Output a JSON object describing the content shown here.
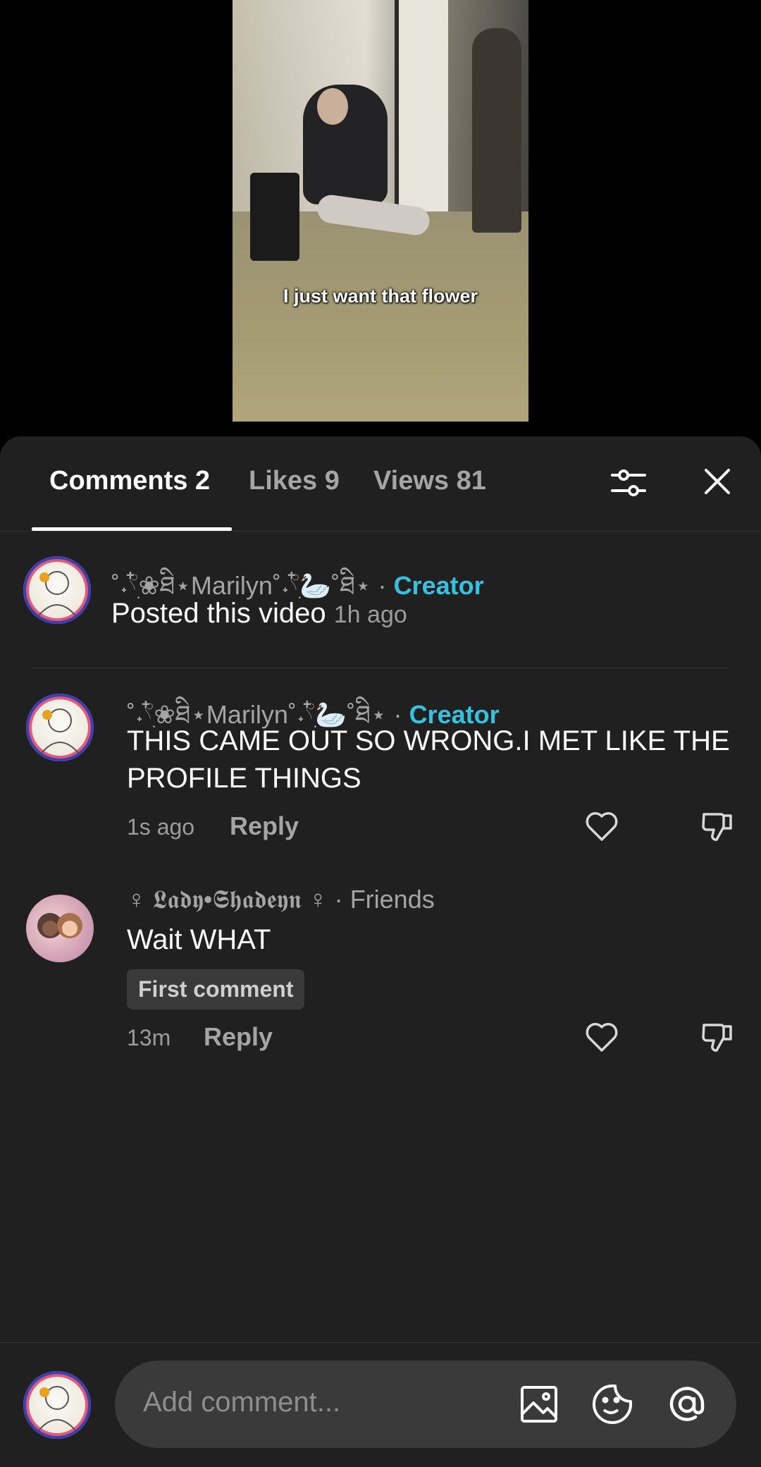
{
  "video": {
    "caption": "I just want that  flower"
  },
  "tabs": [
    {
      "label": "Comments 2",
      "active": true
    },
    {
      "label": "Likes 9",
      "active": false
    },
    {
      "label": "Views 81",
      "active": false
    }
  ],
  "icons": {
    "filter": "sliders-icon",
    "close": "close-icon",
    "like": "heart-icon",
    "dislike": "thumbs-down-icon",
    "image": "image-icon",
    "emoji": "emoji-icon",
    "mention": "at-icon"
  },
  "colors": {
    "creator": "#34c2e0",
    "sheet_bg": "#202020"
  },
  "post": {
    "username": "˚˖𓍢ִ໋❀ཐི⋆Marilyn˚˖𓍢ִ໋🦢˚ཐི⋆",
    "separator": "·",
    "role": "Creator",
    "text": "Posted this video",
    "time": "1h ago"
  },
  "comments": [
    {
      "username": "˚˖𓍢ִ໋❀ཐི⋆Marilyn˚˖𓍢ִ໋🦢˚ཐི⋆",
      "separator": "·",
      "role": "Creator",
      "text": "THIS CAME OUT SO WRONG.I MET LIKE THE PROFILE THINGS",
      "time": "1s ago",
      "reply": "Reply"
    },
    {
      "username": "♀ 𝕷𝖆𝖉𝖞•𝕾𝖍𝖆𝖉𝖊𝖞𝖓 ♀",
      "separator": "·",
      "role": "Friends",
      "text": "Wait WHAT",
      "badge": "First comment",
      "time": "13m",
      "reply": "Reply"
    }
  ],
  "composer": {
    "placeholder": "Add comment..."
  }
}
